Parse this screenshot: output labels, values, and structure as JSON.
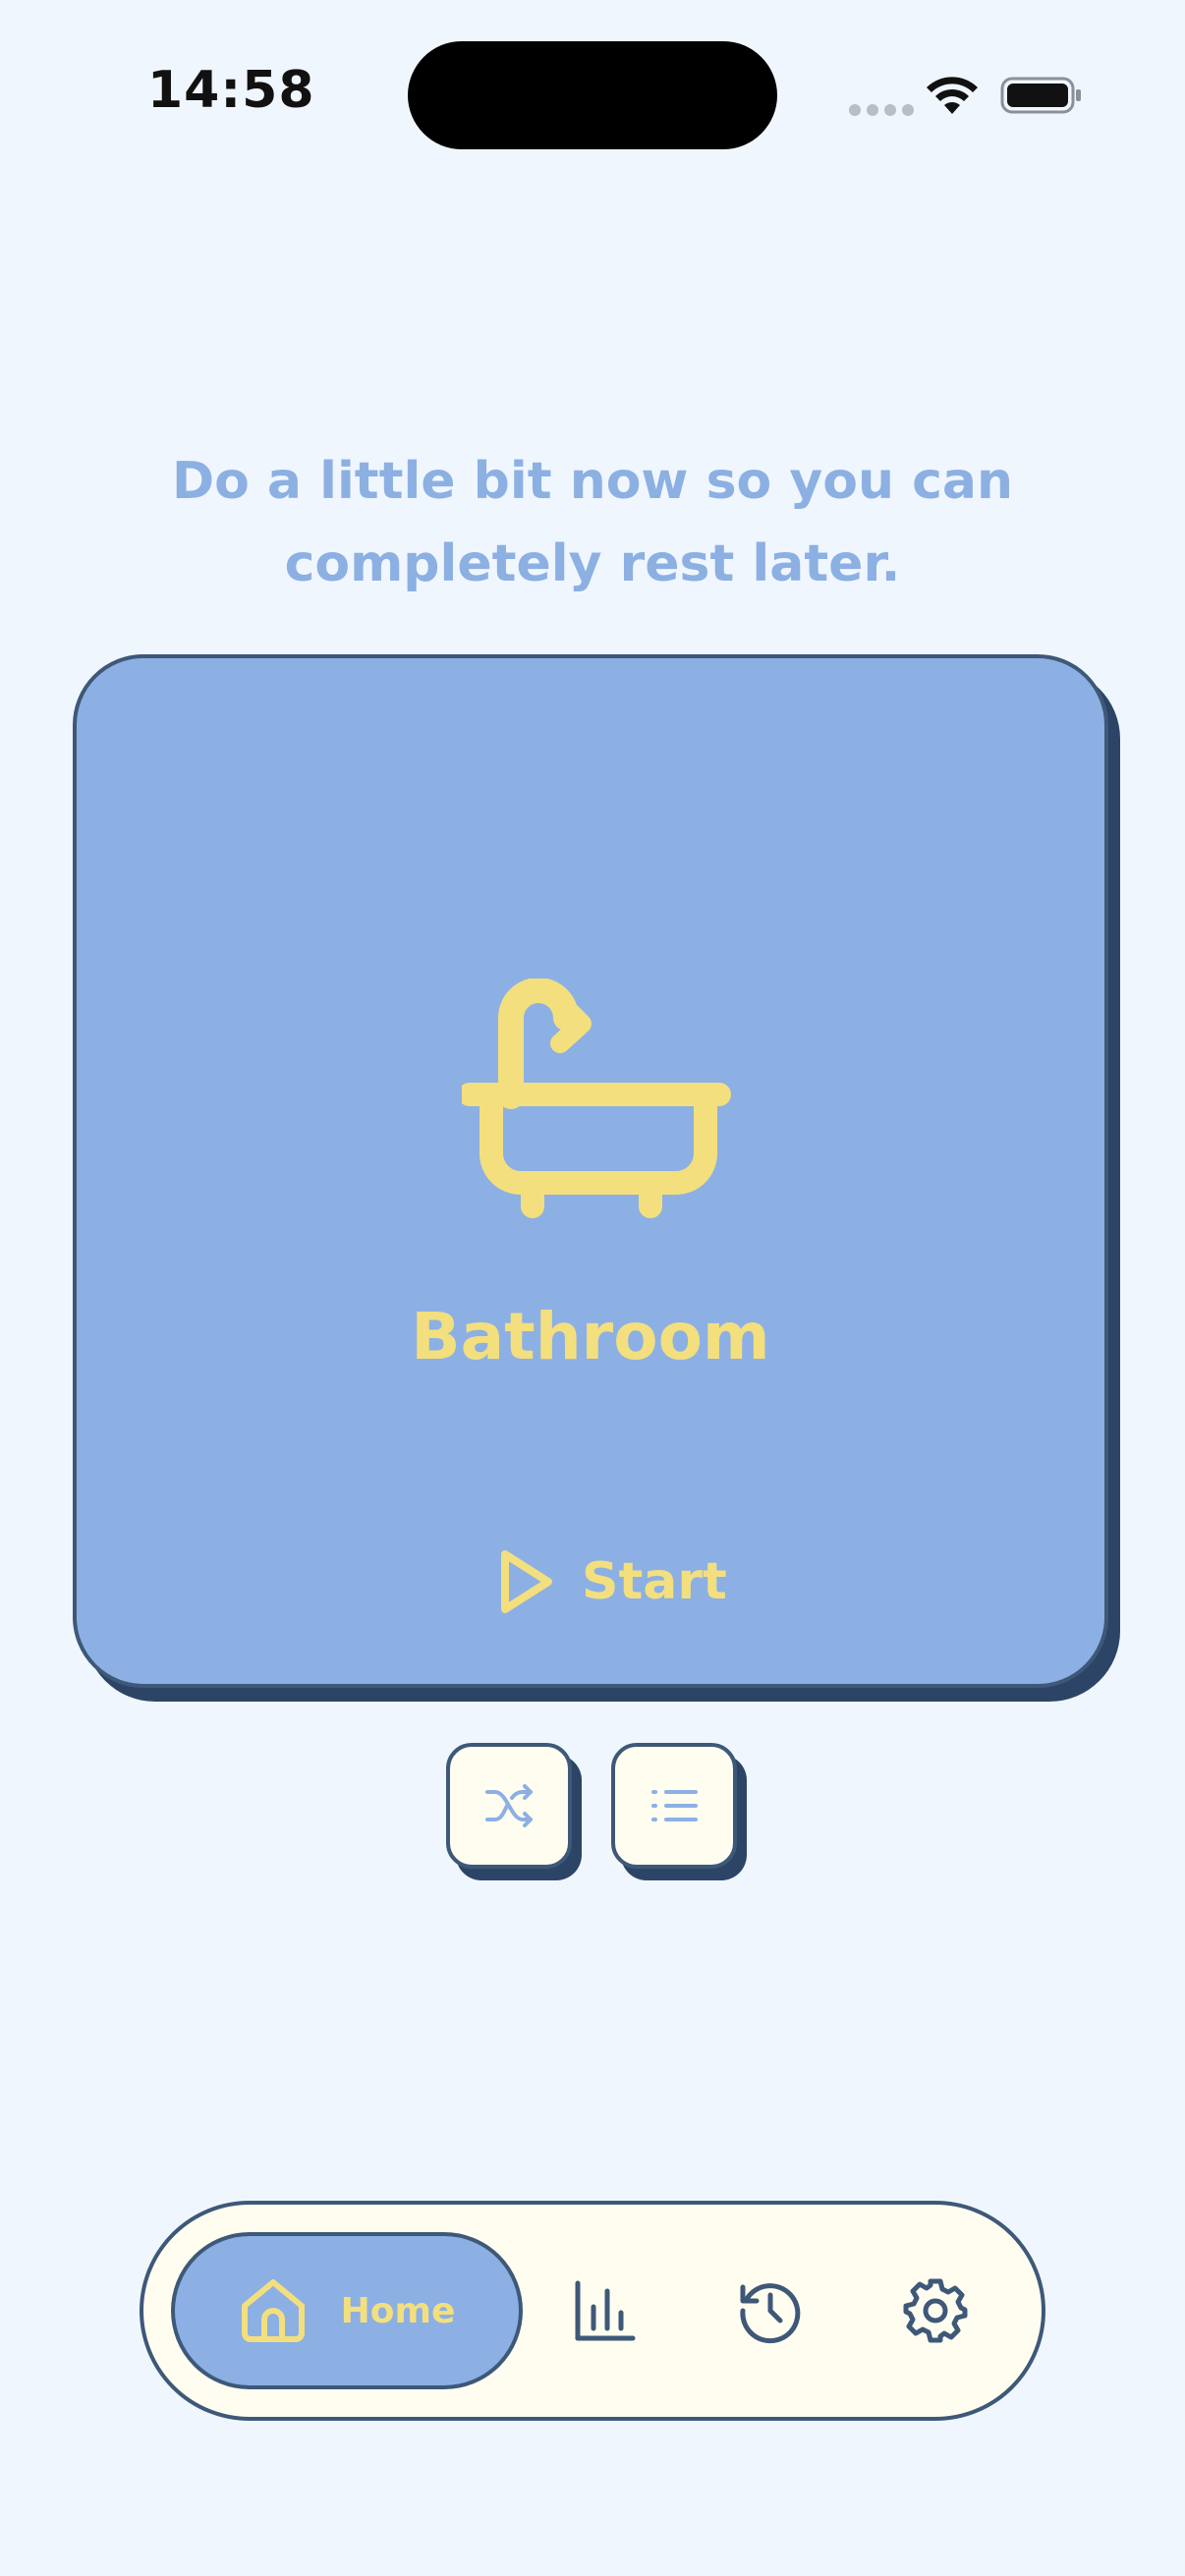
{
  "status_bar": {
    "time": "14:58"
  },
  "quote": "Do a little bit now so you can completely rest later.",
  "task_card": {
    "icon": "bathtub-icon",
    "name": "Bathroom",
    "start_label": "Start"
  },
  "actions": {
    "shuffle_icon": "shuffle-icon",
    "list_icon": "list-icon"
  },
  "tab_bar": {
    "home_label": "Home",
    "tabs": [
      "home-icon",
      "bar-chart-icon",
      "history-icon",
      "gear-icon"
    ]
  },
  "colors": {
    "background": "#f0f6fe",
    "card_blue": "#8cb0e4",
    "accent_yellow": "#f3df7e",
    "outline_navy": "#3e5878",
    "cream": "#fffdf0"
  }
}
